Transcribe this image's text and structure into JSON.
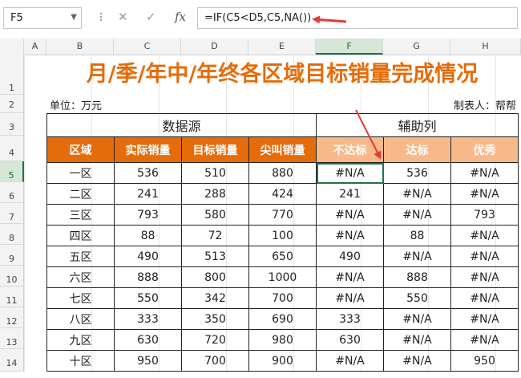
{
  "formula_bar": {
    "name_box": "F5",
    "cancel_icon": "✕",
    "enter_icon": "✓",
    "fx_label": "fx",
    "formula": "=IF(C5<D5,C5,NA())"
  },
  "columns": [
    "A",
    "B",
    "C",
    "D",
    "E",
    "F",
    "G",
    "H"
  ],
  "rows": [
    "1",
    "2",
    "3",
    "4",
    "5",
    "6",
    "7",
    "8",
    "9",
    "10",
    "11",
    "12",
    "13",
    "14"
  ],
  "sheet": {
    "title": "月/季/年中/年终各区域目标销量完成情况",
    "unit_label": "单位：万元",
    "author_label": "制表人：帮帮",
    "group_source": "数据源",
    "group_aux": "辅助列",
    "headers": [
      "区域",
      "实际销量",
      "目标销量",
      "尖叫销量",
      "不达标",
      "达标",
      "优秀"
    ],
    "rows": [
      [
        "一区",
        "536",
        "510",
        "880",
        "#N/A",
        "536",
        "#N/A"
      ],
      [
        "二区",
        "241",
        "288",
        "424",
        "241",
        "#N/A",
        "#N/A"
      ],
      [
        "三区",
        "793",
        "580",
        "770",
        "#N/A",
        "#N/A",
        "793"
      ],
      [
        "四区",
        "88",
        "72",
        "100",
        "#N/A",
        "88",
        "#N/A"
      ],
      [
        "五区",
        "490",
        "513",
        "650",
        "490",
        "#N/A",
        "#N/A"
      ],
      [
        "六区",
        "888",
        "800",
        "1000",
        "#N/A",
        "888",
        "#N/A"
      ],
      [
        "七区",
        "550",
        "342",
        "700",
        "#N/A",
        "550",
        "#N/A"
      ],
      [
        "八区",
        "333",
        "350",
        "690",
        "333",
        "#N/A",
        "#N/A"
      ],
      [
        "九区",
        "630",
        "720",
        "980",
        "630",
        "#N/A",
        "#N/A"
      ],
      [
        "十区",
        "950",
        "700",
        "900",
        "#N/A",
        "#N/A",
        "950"
      ]
    ]
  },
  "colors": {
    "accent_orange": "#e46c0a",
    "aux_header": "#f8b98a",
    "arrow_red": "#e03c3c",
    "selection_green": "#217346"
  }
}
